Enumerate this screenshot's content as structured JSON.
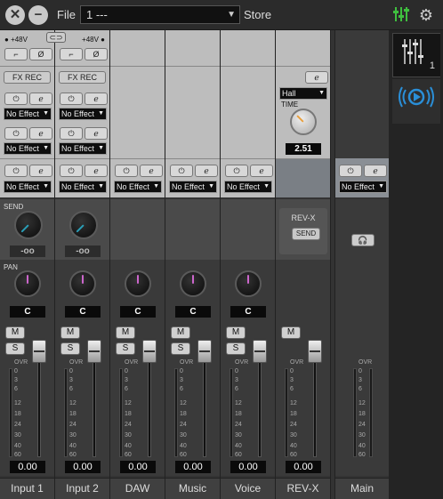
{
  "topbar": {
    "file_label": "File",
    "file_value": "1   ---",
    "store_label": "Store"
  },
  "sidebar": {
    "tab1_label": "1"
  },
  "icons": [
    "close-icon",
    "minimize-icon",
    "dropdown-arrow-icon",
    "mixer-icon",
    "gear-icon",
    "reverb-wave-icon",
    "power-icon",
    "edit-icon",
    "phase-icon",
    "hpf-icon",
    "link-icon",
    "headphones-icon"
  ],
  "colors": {
    "accent_green": "#3fbf3f",
    "accent_blue": "#2a8fd8",
    "send_indicator": "#2a9fb8",
    "pan_indicator": "#cc66cc",
    "rev_time_indicator": "#e8a040"
  },
  "input_section": {
    "phantom_label": "+48V",
    "fx_rec_label": "FX REC",
    "no_effect": "No Effect"
  },
  "labels": {
    "send": "SEND",
    "pan": "PAN",
    "mute": "M",
    "solo": "S",
    "reverb_time": "TIME"
  },
  "reverb": {
    "type": "Hall",
    "time_value": "2.51",
    "revx_label": "REV-X",
    "send_btn": "SEND"
  },
  "scale": [
    "OVR",
    "0",
    "3",
    "6",
    "12",
    "18",
    "24",
    "30",
    "40",
    "60"
  ],
  "channels": [
    {
      "name": "Input 1",
      "send_value": "-oo",
      "pan_value": "C",
      "gain": "0.00"
    },
    {
      "name": "Input 2",
      "send_value": "-oo",
      "pan_value": "C",
      "gain": "0.00"
    },
    {
      "name": "DAW",
      "pan_value": "C",
      "gain": "0.00"
    },
    {
      "name": "Music",
      "pan_value": "C",
      "gain": "0.00"
    },
    {
      "name": "Voice",
      "pan_value": "C",
      "gain": "0.00"
    },
    {
      "name": "REV-X",
      "gain": "0.00"
    },
    {
      "name": "Main"
    }
  ]
}
